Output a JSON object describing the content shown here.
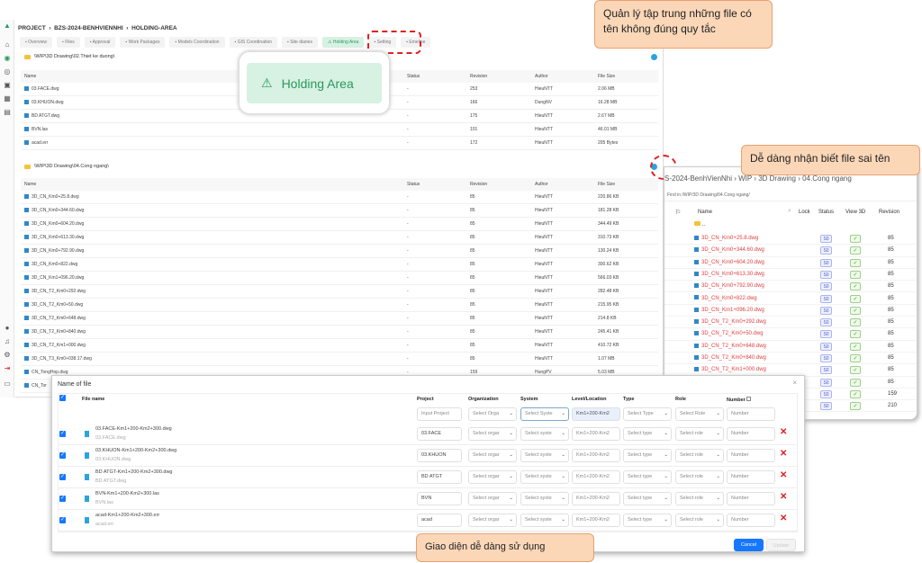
{
  "breadcrumb": [
    "PROJECT",
    "BZS-2024-BENHVIENNHI",
    "HOLDING-AREA"
  ],
  "tabs": [
    {
      "label": "Overview",
      "icon": "chart-icon"
    },
    {
      "label": "Files",
      "icon": "folder-icon"
    },
    {
      "label": "Approval",
      "icon": "doc-icon"
    },
    {
      "label": "Work Packages",
      "icon": "package-icon"
    },
    {
      "label": "Models Coordination",
      "icon": "model-icon"
    },
    {
      "label": "GIS Coordination",
      "icon": "globe-icon"
    },
    {
      "label": "Site diaries",
      "icon": "diary-icon"
    },
    {
      "label": "Holding Area",
      "icon": "warning-icon",
      "active": true
    },
    {
      "label": "Setting",
      "icon": "gear-icon"
    },
    {
      "label": "Emeline",
      "icon": "calendar-icon"
    }
  ],
  "holding_zoom_label": "Holding Area",
  "columns": {
    "name": "Name",
    "status": "Status",
    "revision": "Revision",
    "author": "Author",
    "size": "File Size"
  },
  "sections": [
    {
      "path": "\\WIP\\3D Drawing\\02.Thiet ke duong\\",
      "rows": [
        {
          "name": "03.FACE.dwg",
          "status": "-",
          "revision": "253",
          "author": "HieuNTT",
          "size": "2.06 MB"
        },
        {
          "name": "03.KHUON.dwg",
          "status": "-",
          "revision": "166",
          "author": "DungNV",
          "size": "16.28 MB"
        },
        {
          "name": "BD ATGT.dwg",
          "status": "-",
          "revision": "175",
          "author": "HieuNTT",
          "size": "2.67 MB"
        },
        {
          "name": "BVN.las",
          "status": "-",
          "revision": "101",
          "author": "HieuNTT",
          "size": "46.01 MB"
        },
        {
          "name": "acad.err",
          "status": "-",
          "revision": "172",
          "author": "HieuNTT",
          "size": "205 Bytes"
        }
      ]
    },
    {
      "path": "\\WIP\\3D Drawing\\04.Cong ngang\\",
      "rows": [
        {
          "name": "3D_CN_Km0+25.8.dwg",
          "status": "-",
          "revision": "85",
          "author": "HieuNTT",
          "size": "220.86 KB"
        },
        {
          "name": "3D_CN_Km0+344.60.dwg",
          "status": "-",
          "revision": "85",
          "author": "HieuNTT",
          "size": "181.28 KB"
        },
        {
          "name": "3D_CN_Km0+604.20.dwg",
          "status": "-",
          "revision": "85",
          "author": "HieuNTT",
          "size": "344.49 KB"
        },
        {
          "name": "3D_CN_Km0+613.30.dwg",
          "status": "-",
          "revision": "85",
          "author": "HieuNTT",
          "size": "310.73 KB"
        },
        {
          "name": "3D_CN_Km0+792.90.dwg",
          "status": "-",
          "revision": "85",
          "author": "HieuNTT",
          "size": "130.24 KB"
        },
        {
          "name": "3D_CN_Km0+822.dwg",
          "status": "-",
          "revision": "85",
          "author": "HieuNTT",
          "size": "300.62 KB"
        },
        {
          "name": "3D_CN_Km1+096.20.dwg",
          "status": "-",
          "revision": "85",
          "author": "HieuNTT",
          "size": "566.03 KB"
        },
        {
          "name": "3D_CN_T2_Km0+292.dwg",
          "status": "-",
          "revision": "85",
          "author": "HieuNTT",
          "size": "282.48 KB"
        },
        {
          "name": "3D_CN_T2_Km0+50.dwg",
          "status": "-",
          "revision": "85",
          "author": "HieuNTT",
          "size": "215.95 KB"
        },
        {
          "name": "3D_CN_T2_Km0+648.dwg",
          "status": "-",
          "revision": "85",
          "author": "HieuNTT",
          "size": "214.8 KB"
        },
        {
          "name": "3D_CN_T2_Km0+840.dwg",
          "status": "-",
          "revision": "85",
          "author": "HieuNTT",
          "size": "245.41 KB"
        },
        {
          "name": "3D_CN_T2_Km1+000.dwg",
          "status": "-",
          "revision": "85",
          "author": "HieuNTT",
          "size": "410.72 KB"
        },
        {
          "name": "3D_CN_T3_Km0+038.17.dwg",
          "status": "-",
          "revision": "85",
          "author": "HieuNTT",
          "size": "1.07 MB"
        },
        {
          "name": "CN_TongHop.dwg",
          "status": "-",
          "revision": "159",
          "author": "HungPV",
          "size": "5.03 MB"
        },
        {
          "name": "CN_Tor",
          "status": "",
          "revision": "",
          "author": "",
          "size": ""
        }
      ]
    }
  ],
  "callouts": {
    "top": "Quản lý tập trung những file có tên không đúng quy tắc",
    "right": "Dễ dàng nhận biết file sai tên",
    "bottom": "Giao diện dễ dàng sử dụng"
  },
  "right_panel": {
    "breadcrumb": [
      "S-2024-BenhVienNhi",
      "WIP",
      "3D Drawing",
      "04.Cong ngang"
    ],
    "find_in": "Find in /WIP/3D Drawing/04.Cong ngang/",
    "cols": {
      "name": "Name",
      "lock": "Lock",
      "status": "Status",
      "view3d": "View 3D",
      "revision": "Revision"
    },
    "parent": "..",
    "status_badge": "S0",
    "rows": [
      {
        "name": "3D_CN_Km0+25.8.dwg",
        "revision": "85"
      },
      {
        "name": "3D_CN_Km0+344.60.dwg",
        "revision": "85"
      },
      {
        "name": "3D_CN_Km0+604.20.dwg",
        "revision": "85"
      },
      {
        "name": "3D_CN_Km0+613.30.dwg",
        "revision": "85"
      },
      {
        "name": "3D_CN_Km0+792.90.dwg",
        "revision": "85"
      },
      {
        "name": "3D_CN_Km0+822.dwg",
        "revision": "85"
      },
      {
        "name": "3D_CN_Km1+096.20.dwg",
        "revision": "85"
      },
      {
        "name": "3D_CN_T2_Km0+292.dwg",
        "revision": "85"
      },
      {
        "name": "3D_CN_T2_Km0+50.dwg",
        "revision": "85"
      },
      {
        "name": "3D_CN_T2_Km0+648.dwg",
        "revision": "85"
      },
      {
        "name": "3D_CN_T2_Km0+840.dwg",
        "revision": "85"
      },
      {
        "name": "3D_CN_T2_Km1+000.dwg",
        "revision": "85"
      },
      {
        "name": "",
        "revision": "85"
      },
      {
        "name": "",
        "revision": "159"
      },
      {
        "name": "",
        "revision": "210"
      }
    ],
    "error_color": "#e04040"
  },
  "modal": {
    "title": "Name of file",
    "headers": {
      "file": "File name",
      "project": "Project",
      "org": "Organization",
      "system": "System",
      "level": "Level/Location",
      "type": "Type",
      "role": "Role",
      "number": "Number"
    },
    "filter": {
      "project": "Input Project",
      "org": "Select Orga",
      "system": "Select Syste",
      "level": "Km1+200-Km2",
      "type": "Select Type",
      "role": "Select Role",
      "number": "Number"
    },
    "rows": [
      {
        "new": "03.FACE-Km1+200-Km2+300.dwg",
        "old": "03.FACE.dwg",
        "project": "03.FACE"
      },
      {
        "new": "03.KHUON-Km1+200-Km2+300.dwg",
        "old": "03.KHUON.dwg",
        "project": "03.KHUON"
      },
      {
        "new": "BD ATGT-Km1+200-Km2+300.dwg",
        "old": "BD ATGT.dwg",
        "project": "BD ATGT"
      },
      {
        "new": "BVN-Km1+200-Km2+300.las",
        "old": "BVN.las",
        "project": "BVN"
      },
      {
        "new": "acad-Km1+200-Km2+300.err",
        "old": "acad.err",
        "project": "acad"
      }
    ],
    "row_defaults": {
      "org": "Select orgar",
      "system": "Select syste",
      "level": "Km1+200-Km2",
      "type": "Select type",
      "role": "Select role",
      "number": "Number"
    },
    "cancel": "Cancel",
    "update": "Update"
  },
  "colors": {
    "accent": "#2a9a5a",
    "primary": "#1677ff",
    "callout": "#fbd7b8",
    "danger": "#e02020"
  }
}
